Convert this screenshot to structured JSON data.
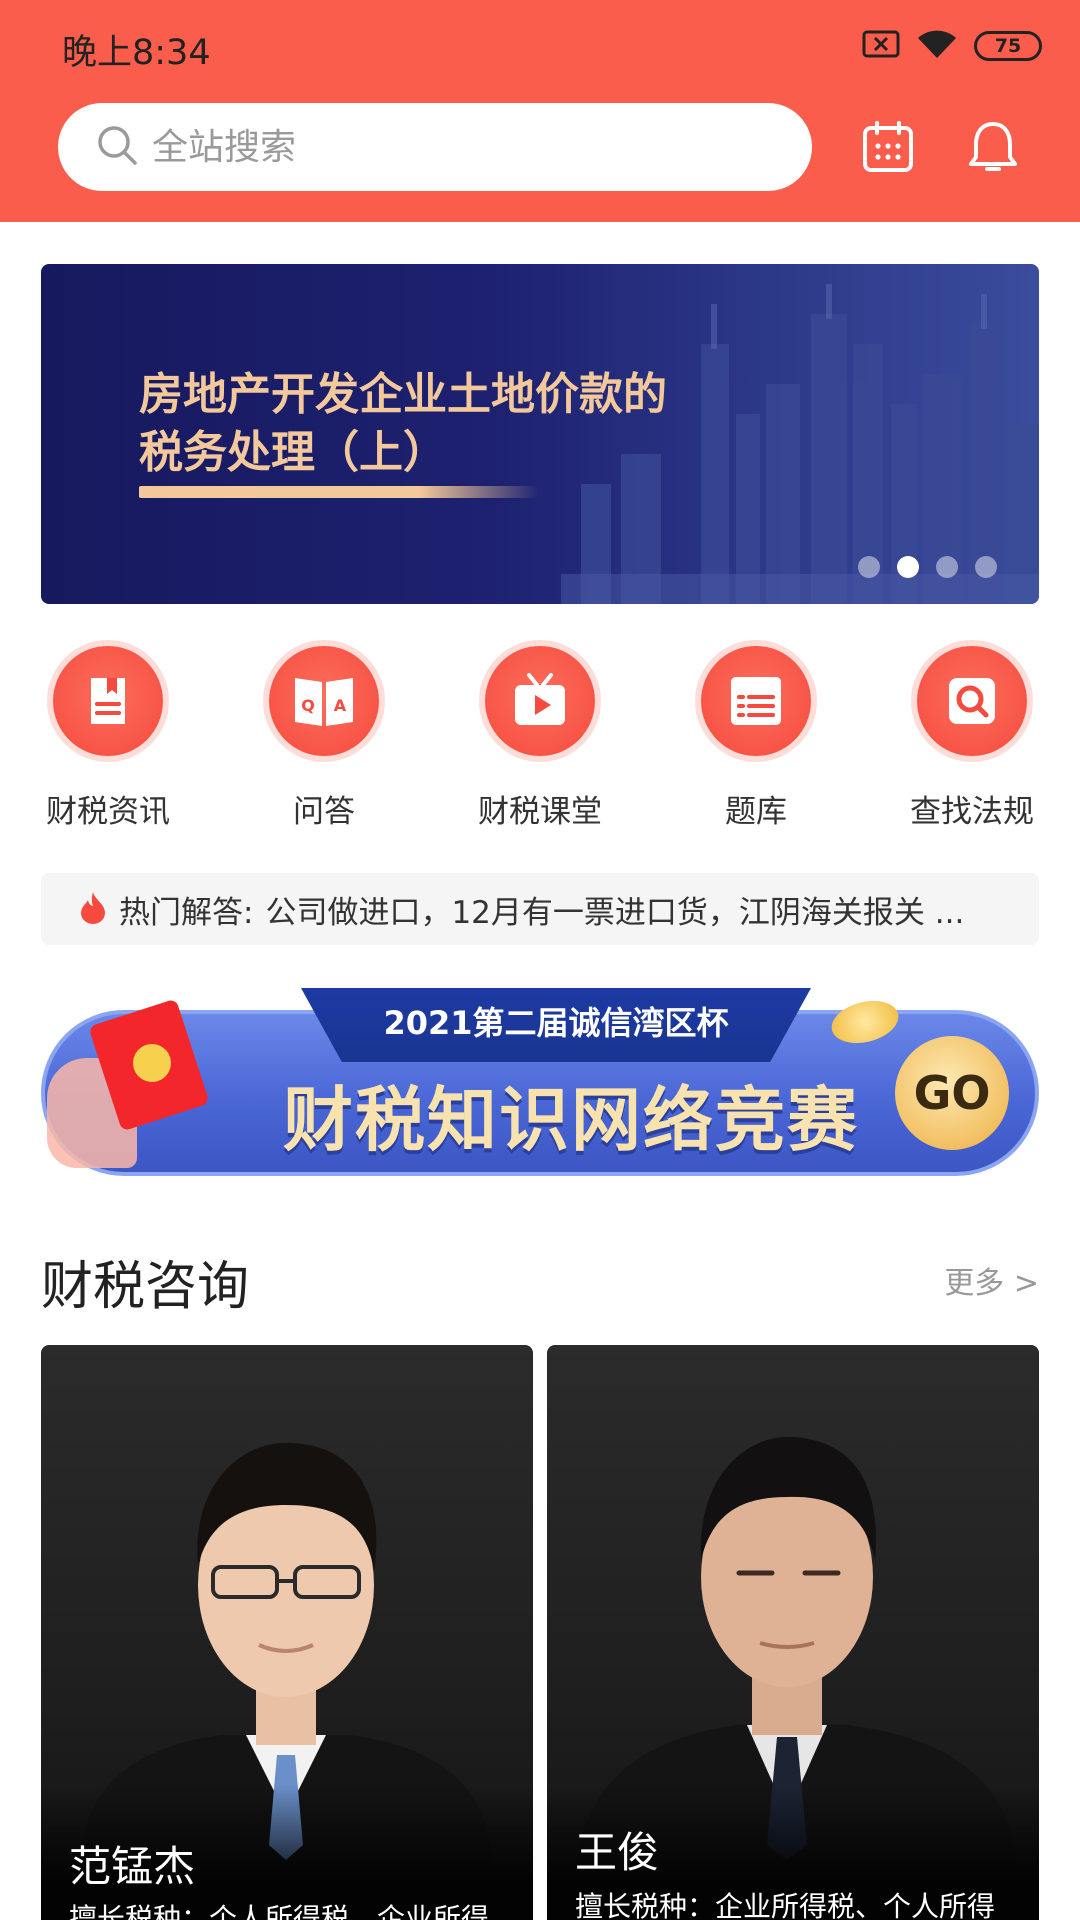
{
  "status_bar": {
    "time": "晚上8:34",
    "battery": "75"
  },
  "search": {
    "placeholder": "全站搜索"
  },
  "banner": {
    "title_line1": "房地产开发企业土地价款的",
    "title_line2": "税务处理（上）",
    "slides": 4,
    "active_slide": 2
  },
  "nav": {
    "items": [
      {
        "label": "财税资讯",
        "icon": "news-icon"
      },
      {
        "label": "问答",
        "icon": "qa-book-icon"
      },
      {
        "label": "财税课堂",
        "icon": "video-class-icon"
      },
      {
        "label": "题库",
        "icon": "question-bank-icon"
      },
      {
        "label": "查找法规",
        "icon": "search-law-icon"
      }
    ]
  },
  "hot": {
    "label": "热门解答:",
    "text": "公司做进口，12月有一票进口货，江阴海关报关 ..."
  },
  "promo": {
    "subtitle": "2021第二届诚信湾区杯",
    "title": "财税知识网络竞赛",
    "go": "GO"
  },
  "consult": {
    "title": "财税咨询",
    "more": "更多 >",
    "experts": [
      {
        "name": "范锰杰",
        "specialty": "擅长税种：个人所得税、企业所得"
      },
      {
        "name": "王俊",
        "specialty": "擅长税种：企业所得税、个人所得"
      }
    ]
  },
  "colors": {
    "brand": "#fb5d4c",
    "banner_bg": "#1d2170",
    "title_gold": "#f3c89a"
  }
}
